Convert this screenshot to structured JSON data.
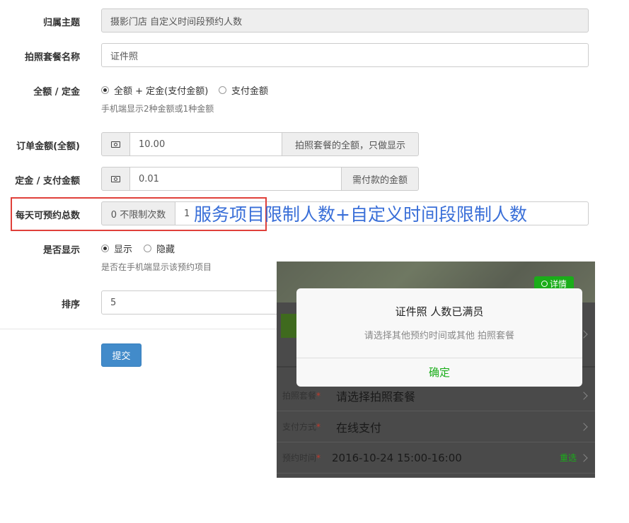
{
  "form": {
    "theme": {
      "label": "归属主题",
      "value": "摄影门店 自定义时间段预约人数"
    },
    "package_name": {
      "label": "拍照套餐名称",
      "value": "证件照"
    },
    "amount_type": {
      "label": "全额 / 定金",
      "option1": "全额 + 定金(支付金额)",
      "option2": "支付金额",
      "help": "手机端显示2种金额或1种金额"
    },
    "order_amount": {
      "label": "订单金额(全额)",
      "value": "10.00",
      "suffix": "拍照套餐的全额，只做显示"
    },
    "deposit": {
      "label": "定金 / 支付金额",
      "value": "0.01",
      "suffix": "需付款的金额"
    },
    "daily_total": {
      "label": "每天可预约总数",
      "prefix": "0 不限制次数",
      "value": "1"
    },
    "display": {
      "label": "是否显示",
      "option1": "显示",
      "option2": "隐藏",
      "help": "是否在手机端显示该预约项目"
    },
    "sort": {
      "label": "排序",
      "value": "5"
    },
    "submit_label": "提交"
  },
  "annotation": "服务项目限制人数+自定义时间段限制人数",
  "phone": {
    "detail_badge": "详情",
    "rows": [
      {
        "label": "拍照套餐",
        "value": "请选择拍照套餐"
      },
      {
        "label": "支付方式",
        "value": "在线支付"
      },
      {
        "label": "预约时间",
        "value": "2016-10-24 15:00-16:00",
        "action": "重选"
      }
    ],
    "dialog": {
      "title": "证件照 人数已满员",
      "message": "请选择其他预约时间或其他 拍照套餐",
      "confirm": "确定"
    }
  }
}
